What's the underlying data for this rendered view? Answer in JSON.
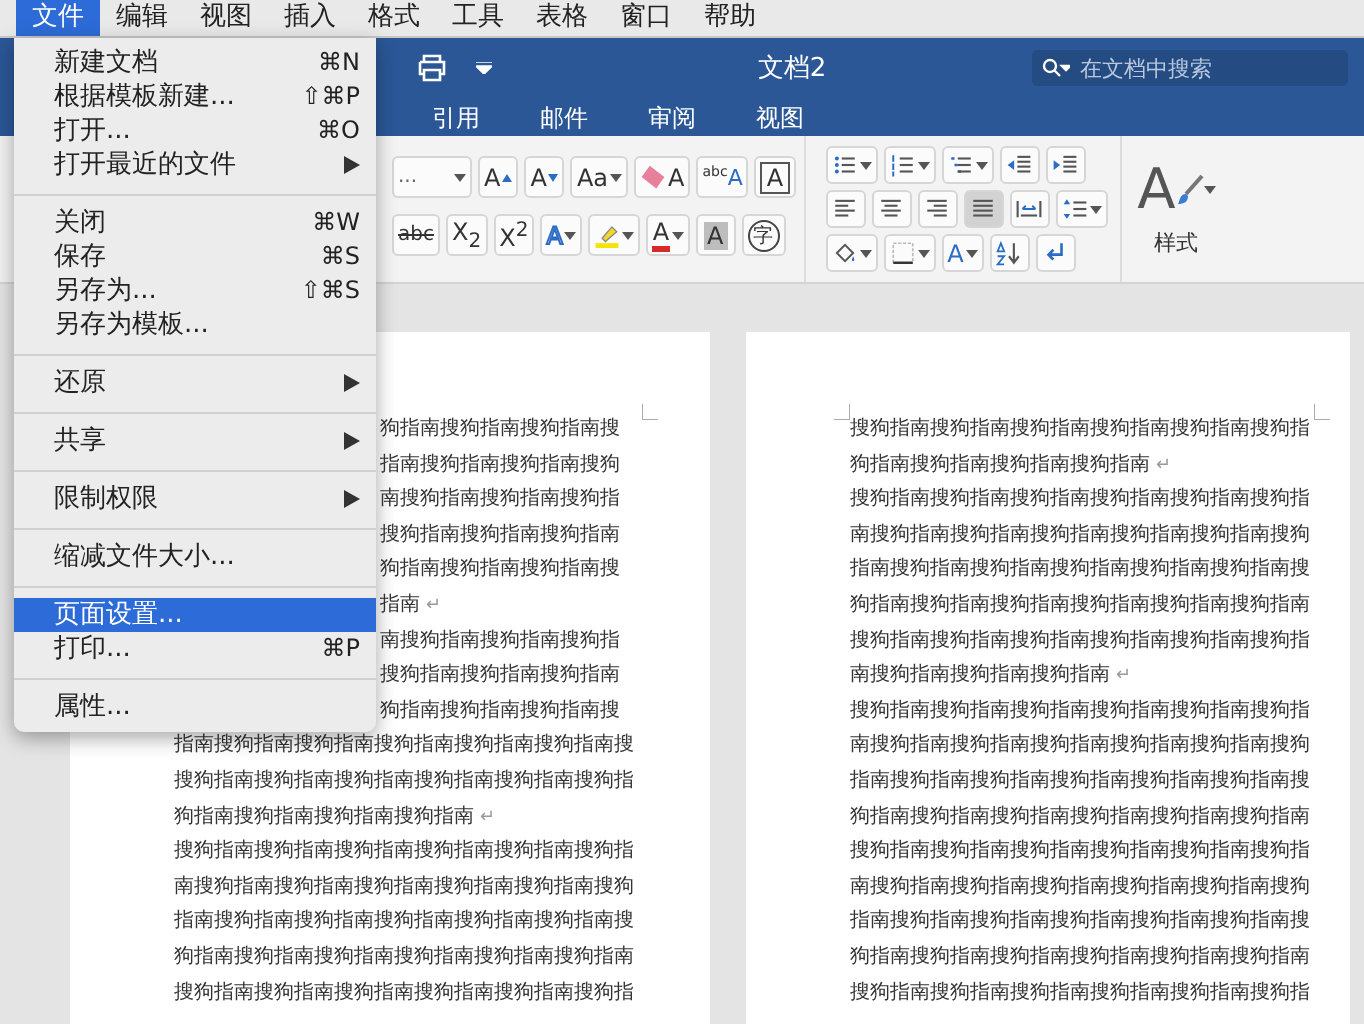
{
  "menubar": [
    {
      "label": "文件",
      "selected": true
    },
    {
      "label": "编辑",
      "selected": false
    },
    {
      "label": "视图",
      "selected": false
    },
    {
      "label": "插入",
      "selected": false
    },
    {
      "label": "格式",
      "selected": false
    },
    {
      "label": "工具",
      "selected": false
    },
    {
      "label": "表格",
      "selected": false
    },
    {
      "label": "窗口",
      "selected": false
    },
    {
      "label": "帮助",
      "selected": false
    }
  ],
  "window": {
    "title": "文档2",
    "search": {
      "placeholder": "在文档中搜索"
    }
  },
  "ribbon_tabs": [
    {
      "label": "引用"
    },
    {
      "label": "邮件"
    },
    {
      "label": "审阅"
    },
    {
      "label": "视图"
    }
  ],
  "ribbon": {
    "font_rows": [
      [
        {
          "kind": "font-size",
          "glyph": "...",
          "dropdown": true
        },
        {
          "kind": "grow",
          "glyph": "A",
          "dropdown": false
        },
        {
          "kind": "shrink",
          "glyph": "A",
          "dropdown": false
        },
        {
          "kind": "case",
          "glyph": "Aa",
          "dropdown": true
        },
        {
          "kind": "clear",
          "glyph": "A",
          "dropdown": false
        },
        {
          "kind": "phonetic",
          "glyph": "$^{abc}$A",
          "dropdown": false
        },
        {
          "kind": "border",
          "glyph": "A",
          "dropdown": false
        }
      ],
      [
        {
          "kind": "strike",
          "glyph": "abc",
          "dropdown": false
        },
        {
          "kind": "subscript",
          "glyph": "X$_{2}$",
          "dropdown": false
        },
        {
          "kind": "superscript",
          "glyph": "X$^{2}$",
          "dropdown": false
        },
        {
          "kind": "effects",
          "glyph": "A",
          "dropdown": true
        },
        {
          "kind": "highlight",
          "dropdown": true
        },
        {
          "kind": "font-color",
          "glyph": "A",
          "dropdown": true
        },
        {
          "kind": "shading",
          "glyph": "A",
          "dropdown": false
        },
        {
          "kind": "enclose",
          "glyph": "字",
          "dropdown": false
        }
      ]
    ],
    "paragraph_rows": [
      [
        {
          "kind": "bullets",
          "dropdown": true
        },
        {
          "kind": "numbering",
          "dropdown": true
        },
        {
          "kind": "multilevel",
          "dropdown": true
        },
        {
          "kind": "outdent",
          "dropdown": false
        },
        {
          "kind": "indent",
          "dropdown": false
        }
      ],
      [
        {
          "kind": "align-left",
          "dropdown": false,
          "selected": false
        },
        {
          "kind": "align-center",
          "dropdown": false,
          "selected": false
        },
        {
          "kind": "align-right",
          "dropdown": false,
          "selected": false
        },
        {
          "kind": "justify",
          "dropdown": false,
          "selected": true
        },
        {
          "kind": "distribute",
          "dropdown": false,
          "selected": false
        },
        {
          "kind": "line-spacing",
          "dropdown": true,
          "selected": false
        }
      ],
      [
        {
          "kind": "fill",
          "dropdown": true
        },
        {
          "kind": "borders",
          "dropdown": true
        },
        {
          "kind": "layout",
          "glyph": "A",
          "dropdown": true
        },
        {
          "kind": "sort",
          "dropdown": false
        },
        {
          "kind": "marks",
          "dropdown": false
        }
      ]
    ],
    "styles": {
      "glyph": "A",
      "label": "样式"
    }
  },
  "file_menu": [
    [
      {
        "label": "新建文档",
        "shortcut": "⌘N",
        "submenu": false,
        "selected": false
      },
      {
        "label": "根据模板新建...",
        "shortcut": "⇧⌘P",
        "submenu": false,
        "selected": false
      },
      {
        "label": "打开...",
        "shortcut": "⌘O",
        "submenu": false,
        "selected": false
      },
      {
        "label": "打开最近的文件",
        "submenu": true,
        "selected": false
      }
    ],
    [
      {
        "label": "关闭",
        "shortcut": "⌘W",
        "submenu": false,
        "selected": false
      },
      {
        "label": "保存",
        "shortcut": "⌘S",
        "submenu": false,
        "selected": false
      },
      {
        "label": "另存为...",
        "shortcut": "⇧⌘S",
        "submenu": false,
        "selected": false
      },
      {
        "label": "另存为模板...",
        "submenu": false,
        "selected": false
      }
    ],
    [
      {
        "label": "还原",
        "submenu": true,
        "selected": false
      }
    ],
    [
      {
        "label": "共享",
        "submenu": true,
        "selected": false
      }
    ],
    [
      {
        "label": "限制权限",
        "submenu": true,
        "selected": false
      }
    ],
    [
      {
        "label": "缩减文件大小...",
        "submenu": false,
        "selected": false
      }
    ],
    [
      {
        "label": "页面设置...",
        "submenu": false,
        "selected": true
      },
      {
        "label": "打印...",
        "shortcut": "⌘P",
        "submenu": false,
        "selected": false
      }
    ],
    [
      {
        "label": "属性...",
        "submenu": false,
        "selected": false
      }
    ]
  ],
  "pages": [
    {
      "lines": [
        {
          "kind": "cut",
          "text": "狗指南搜狗指南搜狗指南搜"
        },
        {
          "kind": "cut",
          "text": "指南搜狗指南搜狗指南搜狗"
        },
        {
          "kind": "cut",
          "text": "南搜狗指南搜狗指南搜狗指"
        },
        {
          "kind": "cut",
          "text": "搜狗指南搜狗指南搜狗指南"
        },
        {
          "kind": "cut",
          "text": "狗指南搜狗指南搜狗指南搜"
        },
        {
          "kind": "cut",
          "text": "指南",
          "end_mark": "↵"
        },
        {
          "kind": "cut",
          "text": "南搜狗指南搜狗指南搜狗指"
        },
        {
          "kind": "cut",
          "text": "搜狗指南搜狗指南搜狗指南"
        },
        {
          "kind": "cut",
          "text": "狗指南搜狗指南搜狗指南搜"
        },
        {
          "kind": "full",
          "text": "指南搜狗指南搜狗指南搜狗指南搜狗指南搜狗指南搜"
        },
        {
          "kind": "full",
          "text": "搜狗指南搜狗指南搜狗指南搜狗指南搜狗指南搜狗指"
        },
        {
          "kind": "full",
          "text": "狗指南搜狗指南搜狗指南搜狗指南",
          "end_mark": "↵"
        },
        {
          "kind": "full",
          "text": "搜狗指南搜狗指南搜狗指南搜狗指南搜狗指南搜狗指"
        },
        {
          "kind": "full",
          "text": "南搜狗指南搜狗指南搜狗指南搜狗指南搜狗指南搜狗"
        },
        {
          "kind": "full",
          "text": "指南搜狗指南搜狗指南搜狗指南搜狗指南搜狗指南搜"
        },
        {
          "kind": "full",
          "text": "狗指南搜狗指南搜狗指南搜狗指南搜狗指南搜狗指南"
        },
        {
          "kind": "full",
          "text": "搜狗指南搜狗指南搜狗指南搜狗指南搜狗指南搜狗指"
        }
      ]
    },
    {
      "lines": [
        {
          "kind": "full",
          "text": "搜狗指南搜狗指南搜狗指南搜狗指南搜狗指南搜狗指"
        },
        {
          "kind": "full",
          "text": "狗指南搜狗指南搜狗指南搜狗指南",
          "end_mark": "↵"
        },
        {
          "kind": "full",
          "text": "搜狗指南搜狗指南搜狗指南搜狗指南搜狗指南搜狗指"
        },
        {
          "kind": "full",
          "text": "南搜狗指南搜狗指南搜狗指南搜狗指南搜狗指南搜狗"
        },
        {
          "kind": "full",
          "text": "指南搜狗指南搜狗指南搜狗指南搜狗指南搜狗指南搜"
        },
        {
          "kind": "full",
          "text": "狗指南搜狗指南搜狗指南搜狗指南搜狗指南搜狗指南"
        },
        {
          "kind": "full",
          "text": "搜狗指南搜狗指南搜狗指南搜狗指南搜狗指南搜狗指"
        },
        {
          "kind": "full",
          "text": "南搜狗指南搜狗指南搜狗指南",
          "end_mark": "↵"
        },
        {
          "kind": "full",
          "text": "搜狗指南搜狗指南搜狗指南搜狗指南搜狗指南搜狗指"
        },
        {
          "kind": "full",
          "text": "南搜狗指南搜狗指南搜狗指南搜狗指南搜狗指南搜狗"
        },
        {
          "kind": "full",
          "text": "指南搜狗指南搜狗指南搜狗指南搜狗指南搜狗指南搜"
        },
        {
          "kind": "full",
          "text": "狗指南搜狗指南搜狗指南搜狗指南搜狗指南搜狗指南"
        },
        {
          "kind": "full",
          "text": "搜狗指南搜狗指南搜狗指南搜狗指南搜狗指南搜狗指"
        },
        {
          "kind": "full",
          "text": "南搜狗指南搜狗指南搜狗指南搜狗指南搜狗指南搜狗"
        },
        {
          "kind": "full",
          "text": "指南搜狗指南搜狗指南搜狗指南搜狗指南搜狗指南搜"
        },
        {
          "kind": "full",
          "text": "狗指南搜狗指南搜狗指南搜狗指南搜狗指南搜狗指南"
        },
        {
          "kind": "full",
          "text": "搜狗指南搜狗指南搜狗指南搜狗指南搜狗指南搜狗指"
        }
      ]
    }
  ]
}
